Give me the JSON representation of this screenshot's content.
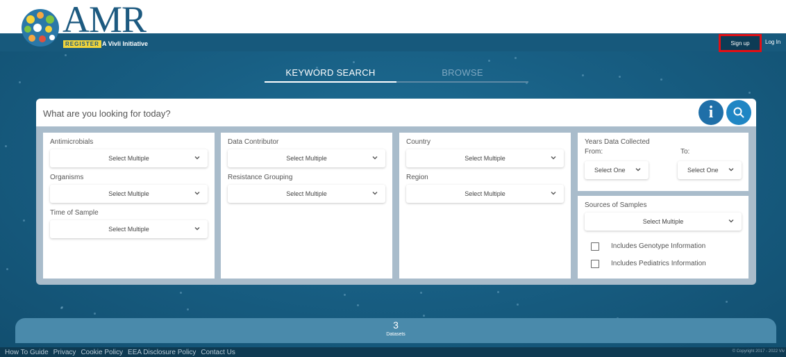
{
  "brand": {
    "name": "AMR",
    "register_badge": "REGISTER",
    "tagline": "A Vivli Initiative",
    "colors": {
      "primary": "#1d5a80",
      "badge": "#f0d43a"
    }
  },
  "header": {
    "signup_label": "Sign up",
    "login_label": "Log In",
    "signup_highlight_color": "#e30f14"
  },
  "tabs": [
    {
      "label": "KEYWORD SEARCH",
      "active": true
    },
    {
      "label": "BROWSE",
      "active": false
    }
  ],
  "search": {
    "placeholder": "What are you looking for today?",
    "info_icon": "info-icon",
    "search_icon": "search-icon"
  },
  "filters": {
    "col1": {
      "antimicrobials": {
        "label": "Antimicrobials",
        "value": "Select Multiple"
      },
      "organisms": {
        "label": "Organisms",
        "value": "Select Multiple"
      },
      "time_of_sample": {
        "label": "Time of Sample",
        "value": "Select Multiple"
      }
    },
    "col2": {
      "data_contributor": {
        "label": "Data Contributor",
        "value": "Select Multiple"
      },
      "resistance_grouping": {
        "label": "Resistance Grouping",
        "value": "Select Multiple"
      }
    },
    "col3": {
      "country": {
        "label": "Country",
        "value": "Select Multiple"
      },
      "region": {
        "label": "Region",
        "value": "Select Multiple"
      }
    },
    "years": {
      "label": "Years Data Collected",
      "from_label": "From:",
      "to_label": "To:",
      "from_value": "Select One",
      "to_value": "Select One"
    },
    "sources": {
      "label": "Sources of Samples",
      "value": "Select Multiple",
      "genotype_label": "Includes Genotype Information",
      "pediatrics_label": "Includes Pediatrics Information"
    }
  },
  "datasets": {
    "count": "3",
    "label": "Datasets"
  },
  "footer": {
    "links": [
      "How To Guide",
      "Privacy",
      "Cookie Policy",
      "EEA Disclosure Policy",
      "Contact Us"
    ],
    "copyright": "© Copyright 2017 - 2022 Viv"
  }
}
